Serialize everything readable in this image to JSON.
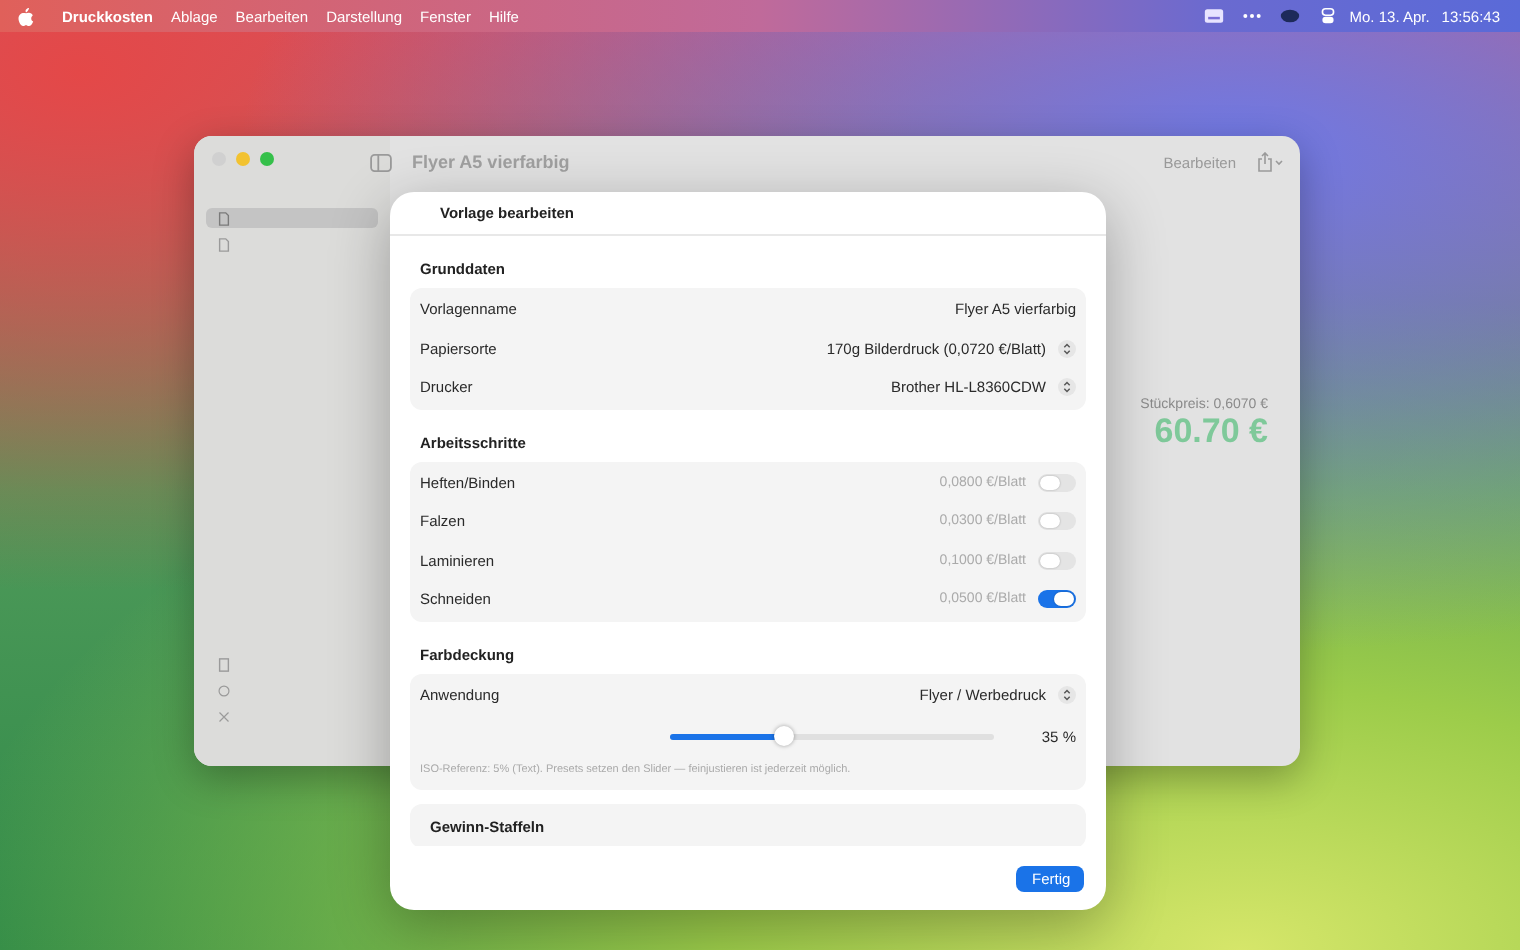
{
  "menubar": {
    "app_name": "Druckkosten",
    "menus": [
      "Ablage",
      "Bearbeiten",
      "Darstellung",
      "Fenster",
      "Hilfe"
    ],
    "date": "Mo. 13. Apr.",
    "time": "13:56:43"
  },
  "sidebar": {
    "items": [
      {
        "selected": true
      },
      {
        "selected": false
      }
    ]
  },
  "window": {
    "title": "Flyer A5 vierfarbig",
    "edit_button": "Bearbeiten",
    "unit_price": "Stückpreis: 0,6070 €",
    "total": "60.70 €"
  },
  "dialog": {
    "title": "Vorlage bearbeiten",
    "sections": [
      {
        "title": "Grunddaten",
        "rows": [
          {
            "kind": "value",
            "label": "Vorlagenname",
            "value": "Flyer A5 vierfarbig"
          },
          {
            "kind": "picker",
            "label": "Papiersorte",
            "value": "170g Bilderdruck (0,0720 €/Blatt)"
          },
          {
            "kind": "picker",
            "label": "Drucker",
            "value": "Brother HL-L8360CDW"
          }
        ]
      },
      {
        "title": "Arbeitsschritte",
        "rows": [
          {
            "kind": "toggle",
            "label": "Heften/Binden",
            "value": "0,0800 €/Blatt",
            "on": false
          },
          {
            "kind": "toggle",
            "label": "Falzen",
            "value": "0,0300 €/Blatt",
            "on": false
          },
          {
            "kind": "toggle",
            "label": "Laminieren",
            "value": "0,1000 €/Blatt",
            "on": false
          },
          {
            "kind": "toggle",
            "label": "Schneiden",
            "value": "0,0500 €/Blatt",
            "on": true
          }
        ]
      }
    ],
    "coverage": {
      "title": "Farbdeckung",
      "label": "Anwendung",
      "value": "Flyer / Werbedruck",
      "level": 0.35,
      "reading": "35 %",
      "note": "ISO-Referenz: 5% (Text). Presets setzen den Slider — feinjustieren ist jederzeit möglich."
    },
    "next_section": "Gewinn-Staffeln",
    "done_button": "Fertig"
  }
}
